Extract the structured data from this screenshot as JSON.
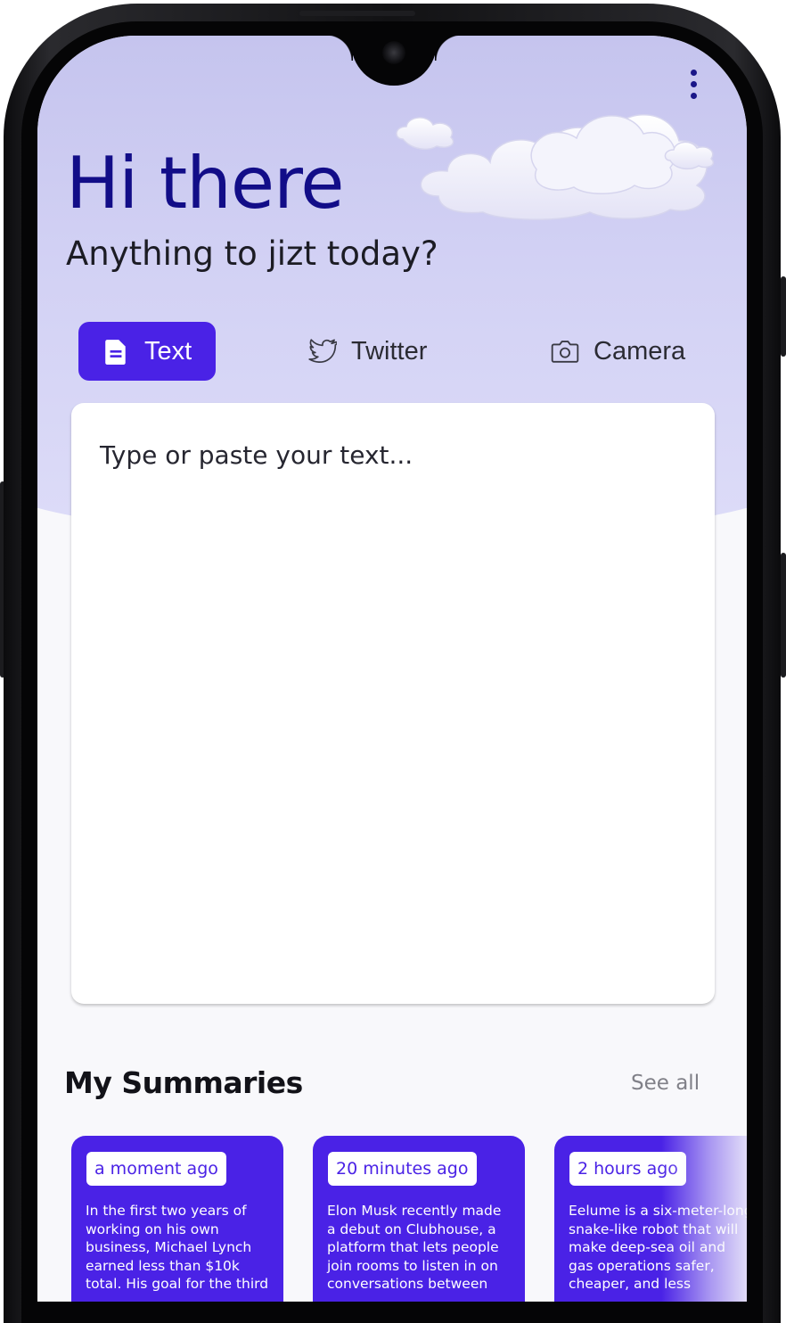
{
  "header": {
    "greeting": "Hi there",
    "subtitle": "Anything to jizt today?"
  },
  "tabs": [
    {
      "label": "Text",
      "icon": "document-icon",
      "active": true
    },
    {
      "label": "Twitter",
      "icon": "twitter-bird-icon",
      "active": false
    },
    {
      "label": "Camera",
      "icon": "camera-icon",
      "active": false
    }
  ],
  "input": {
    "placeholder": "Type or paste your text..."
  },
  "summaries": {
    "title": "My Summaries",
    "see_all": "See all",
    "cards": [
      {
        "time": "a moment ago",
        "text": "In the first two years of working on his own business, Michael Lynch earned less than $10k total. His goal for the third"
      },
      {
        "time": "20 minutes ago",
        "text": "Elon Musk recently made a debut on Clubhouse, a platform that lets people join rooms to listen in on conversations between"
      },
      {
        "time": "2 hours ago",
        "text": "Eelume is a six-meter-long snake-like robot that will make deep-sea oil and gas operations safer, cheaper, and less"
      }
    ]
  },
  "colors": {
    "accent": "#4a22e6",
    "title": "#120d88",
    "hero_top": "#c5c4ee",
    "hero_bottom": "#dddcf8"
  }
}
